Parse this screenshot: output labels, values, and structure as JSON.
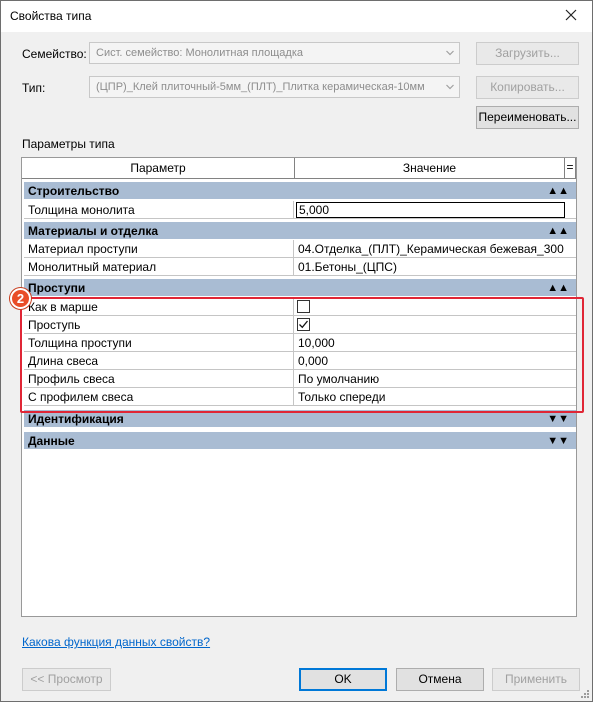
{
  "window": {
    "title": "Свойства типа"
  },
  "family": {
    "label": "Семейство:",
    "value": "Сист. семейство: Монолитная площадка",
    "load_label": "Загрузить..."
  },
  "type": {
    "label": "Тип:",
    "value": "(ЦПР)_Клей плиточный-5мм_(ПЛТ)_Плитка керамическая-10мм",
    "copy_label": "Копировать...",
    "rename_label": "Переименовать..."
  },
  "params_title": "Параметры типа",
  "grid": {
    "col_param": "Параметр",
    "col_value": "Значение",
    "col_corner": "=",
    "groups": [
      {
        "name": "Строительство",
        "chevron": "▲▲",
        "rows": [
          {
            "param": "Толщина монолита",
            "value": "5,000"
          }
        ]
      },
      {
        "name": "Материалы и отделка",
        "chevron": "▲▲",
        "rows": [
          {
            "param": "Материал проступи",
            "value": "04.Отделка_(ПЛТ)_Керамическая бежевая_300"
          },
          {
            "param": "Монолитный материал",
            "value": "01.Бетоны_(ЦПС)"
          }
        ]
      },
      {
        "name": "Проступи",
        "chevron": "▲▲",
        "rows": [
          {
            "param": "Как в марше",
            "value": ""
          },
          {
            "param": "Проступь",
            "value": ""
          },
          {
            "param": "Толщина проступи",
            "value": "10,000"
          },
          {
            "param": "Длина свеса",
            "value": "0,000"
          },
          {
            "param": "Профиль свеса",
            "value": "По умолчанию"
          },
          {
            "param": "С профилем свеса",
            "value": "Только спереди"
          }
        ]
      },
      {
        "name": "Идентификация",
        "chevron": "▼▼",
        "rows": []
      },
      {
        "name": "Данные",
        "chevron": "▼▼",
        "rows": []
      }
    ]
  },
  "checkboxes": {
    "kak_v_marshe": false,
    "prostup": true
  },
  "marker_number": "2",
  "link": "Какова функция данных свойств?",
  "footer": {
    "preview_label": "<< Просмотр",
    "ok_label": "OK",
    "cancel_label": "Отмена",
    "apply_label": "Применить"
  },
  "colors": {
    "group_header_bg": "#a9bcd3",
    "highlight": "#e02636",
    "marker": "#e94d27",
    "link": "#0066cc"
  }
}
